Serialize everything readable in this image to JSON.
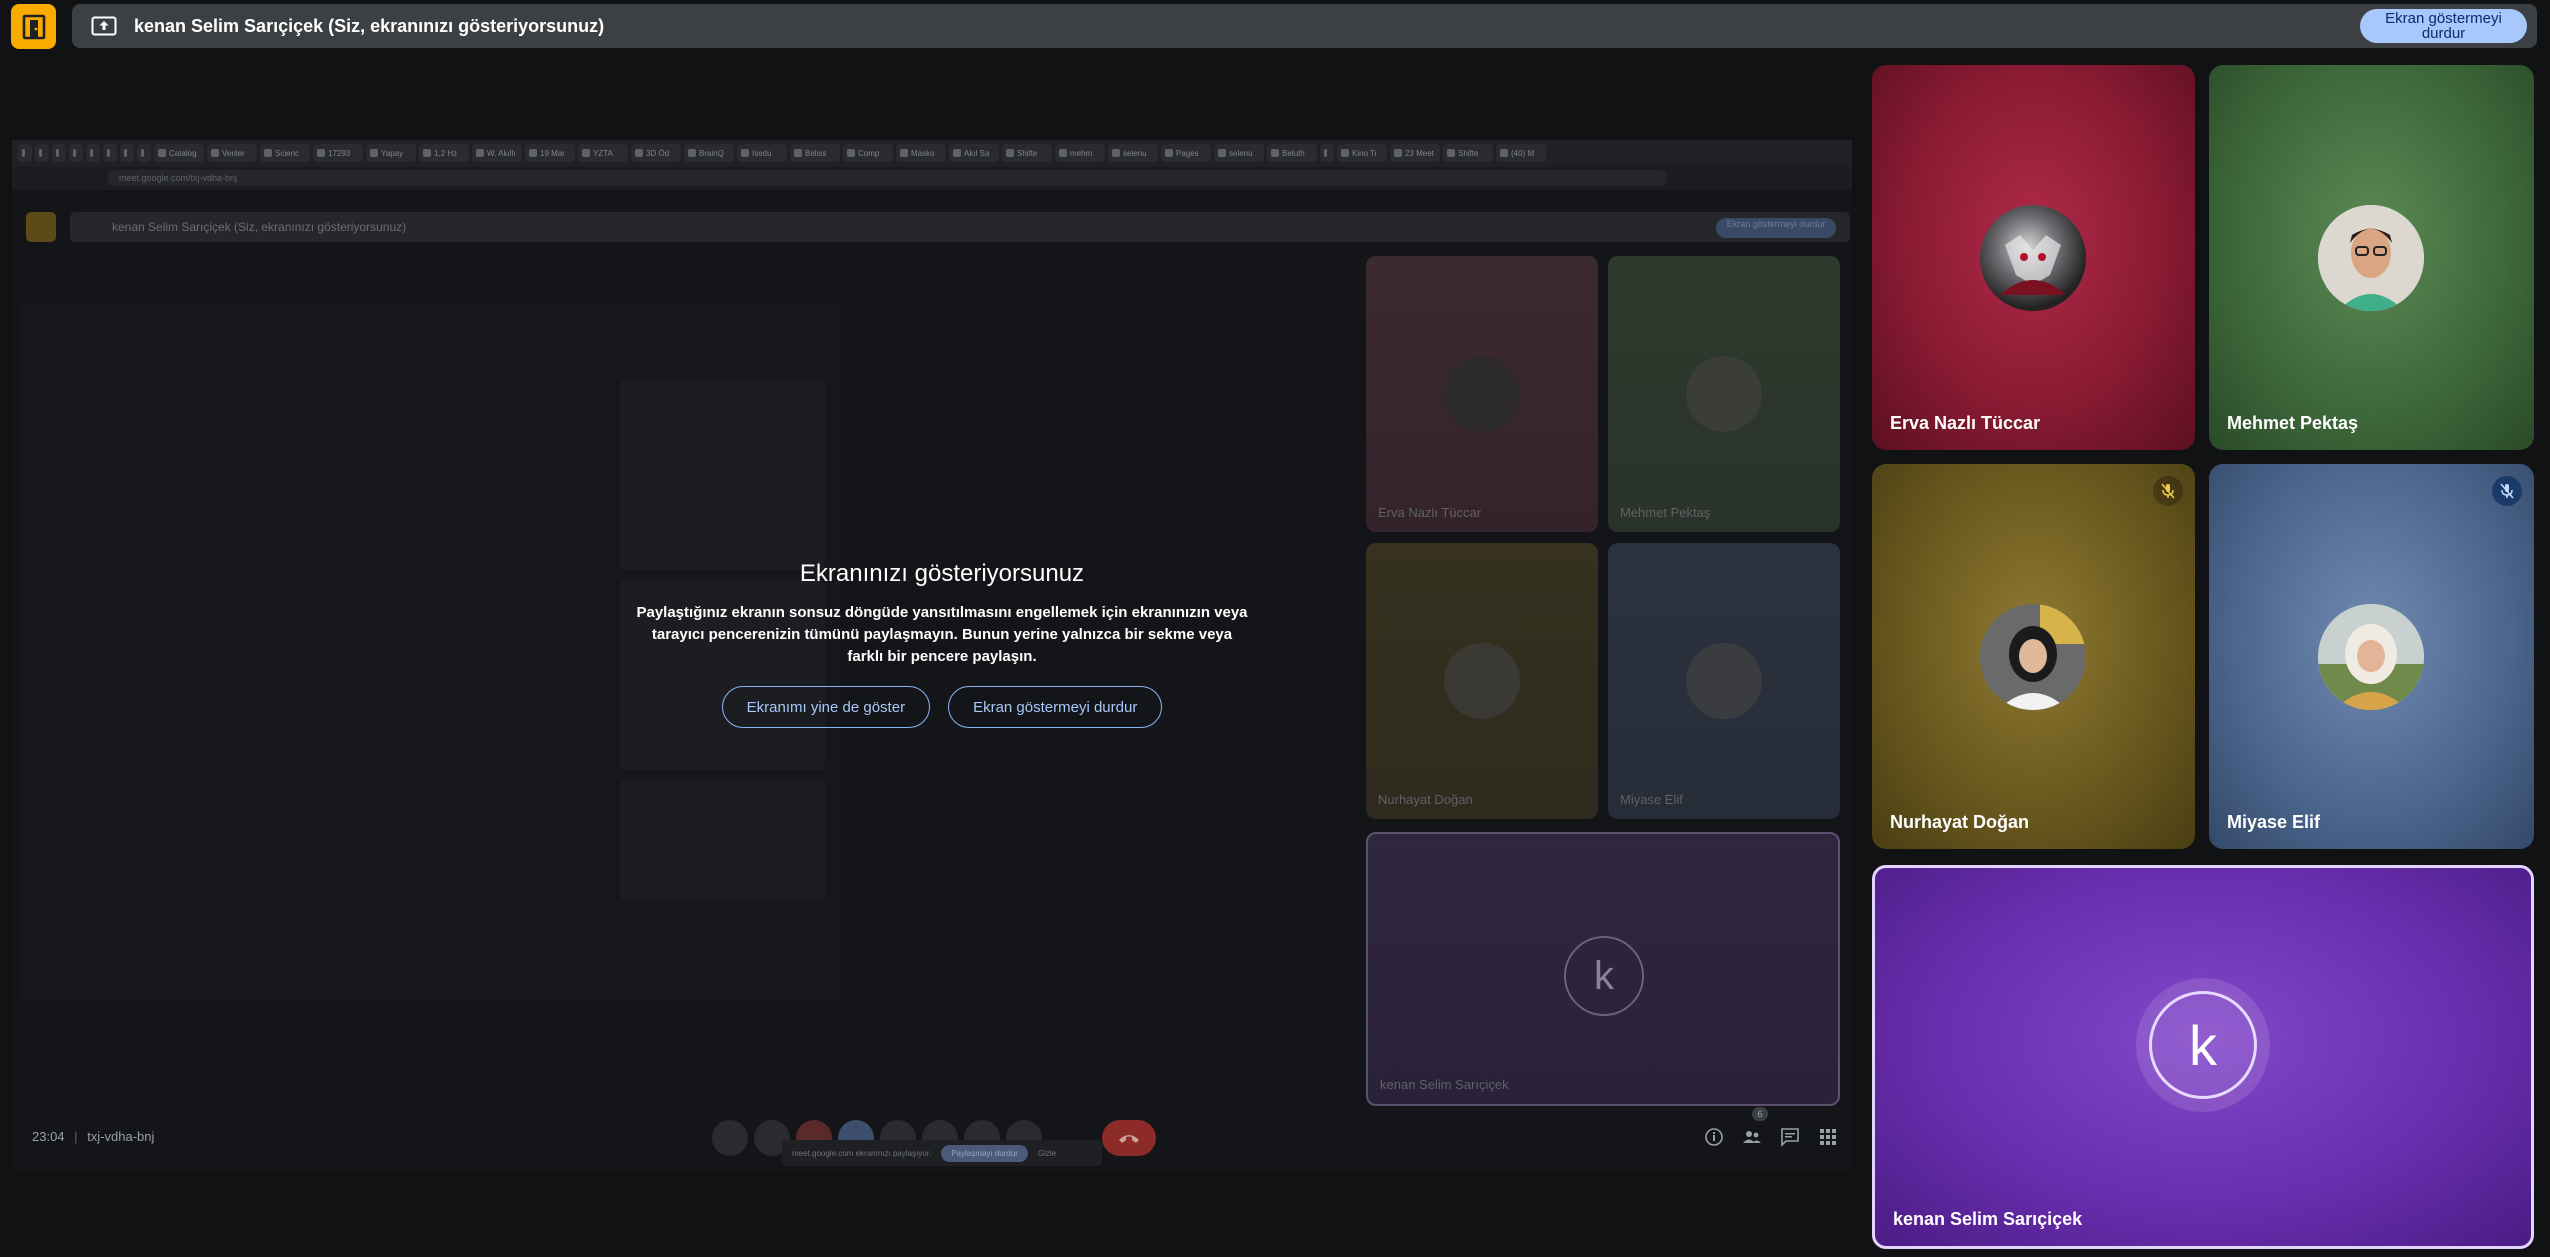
{
  "banner": {
    "text": "kenan Selim Sarıçiçek (Siz, ekranınızı gösteriyorsunuz)",
    "stop_button": "Ekran göstermeyi durdur"
  },
  "dialog": {
    "title": "Ekranınızı gösteriyorsunuz",
    "body": "Paylaştığınız ekranın sonsuz döngüde yansıtılmasını engellemek için ekranınızın veya tarayıcı pencerenizin tümünü paylaşmayın. Bunun yerine yalnızca bir sekme veya farklı bir pencere paylaşın.",
    "show_anyway": "Ekranımı yine de göster",
    "stop": "Ekran göstermeyi durdur"
  },
  "inner_meeting": {
    "time": "23:04",
    "code": "txj-vdha-bnj",
    "url": "meet.google.com/txj-vdha-bnj",
    "info_text": "meet.google.com ekranınızı paylaşıyor.",
    "info_stop": "Paylaşmayı durdur",
    "info_hide": "Gizle",
    "participant_count": "6",
    "nested_banner": "kenan Selim Sarıçiçek (Siz, ekranınızı gösteriyorsunuz)",
    "nested_stop": "Ekran göstermeyi durdur",
    "tabs": [
      "",
      "",
      "",
      "",
      "",
      "",
      "",
      "",
      "Catalog",
      "Veriler",
      "Scienc",
      "17293",
      "Yapay",
      "1,2 Hz",
      "W. Akıllı",
      "19 Mar",
      "YZTA",
      "3D Öd",
      "BrainQ",
      "Isedu",
      "Beliss",
      "Comp",
      "Masko",
      "Akıl Sa",
      "Shifte",
      "mehm",
      "selenu",
      "Pages",
      "selenu",
      "Beluth",
      "",
      "Kino Tr",
      "23 Meet",
      "Shifte",
      "(40) M"
    ],
    "tiles": [
      {
        "name": "Erva Nazlı Tüccar"
      },
      {
        "name": "Mehmet Pektaş"
      },
      {
        "name": "Nurhayat Doğan"
      },
      {
        "name": "Miyase Elif"
      },
      {
        "name": "kenan Selim Sarıçiçek",
        "initial": "k"
      }
    ]
  },
  "participants": [
    {
      "name": "Erva Nazlı Tüccar",
      "muted": false,
      "color": "#8a1b30"
    },
    {
      "name": "Mehmet Pektaş",
      "muted": false,
      "color": "#3f6b3c"
    },
    {
      "name": "Nurhayat Doğan",
      "muted": true,
      "color": "#6b5a1e"
    },
    {
      "name": "Miyase Elif",
      "muted": true,
      "color": "#4e6990"
    },
    {
      "name": "kenan Selim Sarıçiçek",
      "initial": "k",
      "color": "#6a2fb0"
    }
  ],
  "colors": {
    "accent": "#a8c7fa",
    "logo": "#f9ab00",
    "active_border": "#e3d4ff"
  }
}
